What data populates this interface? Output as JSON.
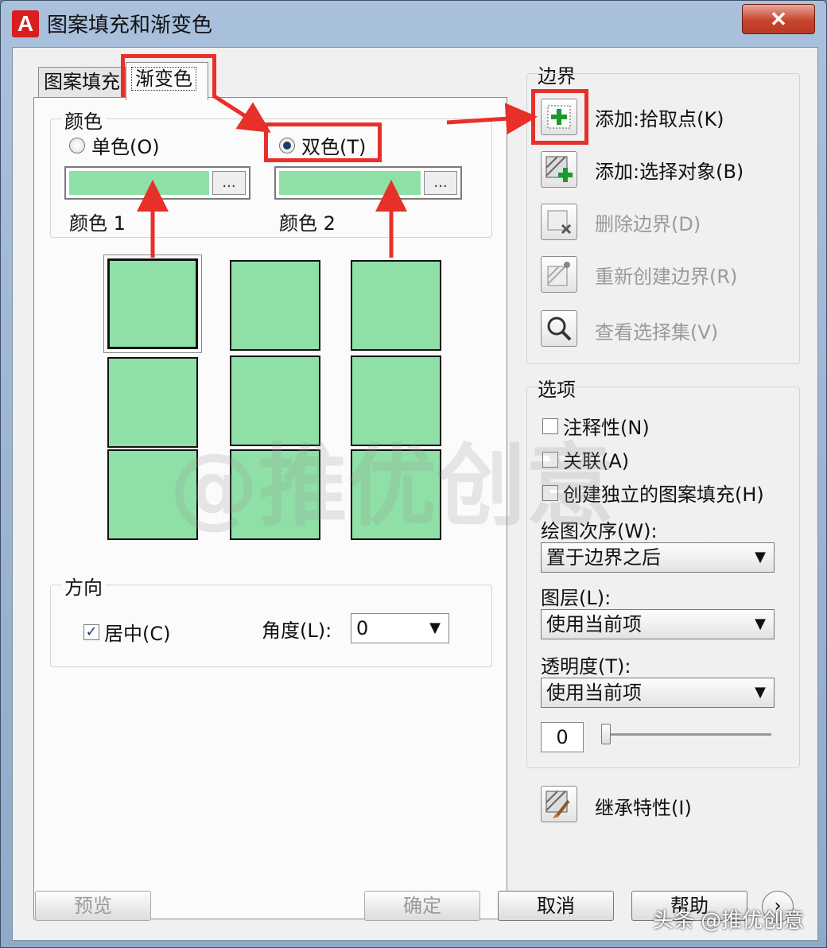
{
  "window": {
    "title": "图案填充和渐变色",
    "app_icon": "A",
    "close_glyph": "✕"
  },
  "tabs": [
    {
      "label": "图案填充"
    },
    {
      "label": "渐变色"
    }
  ],
  "color_group": {
    "label": "颜色",
    "single_color": "单色(O)",
    "two_color": "双色(T)",
    "color1_label": "颜色 1",
    "color2_label": "颜色 2",
    "color1_value": "#8fe0a6",
    "color2_value": "#8fe0a6",
    "browse": "..."
  },
  "swatch_color": "#8fe0a6",
  "direction_group": {
    "label": "方向",
    "centered": "居中(C)",
    "angle_label": "角度(L):",
    "angle_value": "0"
  },
  "boundary": {
    "label": "边界",
    "add_pick_points": "添加:拾取点(K)",
    "add_select_objects": "添加:选择对象(B)",
    "remove_boundaries": "删除边界(D)",
    "recreate_boundary": "重新创建边界(R)",
    "view_selections": "查看选择集(V)"
  },
  "options": {
    "label": "选项",
    "annotative": "注释性(N)",
    "associative": "关联(A)",
    "separate_hatches": "创建独立的图案填充(H)",
    "draw_order_label": "绘图次序(W):",
    "draw_order_value": "置于边界之后",
    "layer_label": "图层(L):",
    "layer_value": "使用当前项",
    "transparency_label": "透明度(T):",
    "transparency_value": "使用当前项",
    "transparency_number": "0"
  },
  "inherit_properties": "继承特性(I)",
  "footer": {
    "preview": "预览",
    "ok": "确定",
    "cancel": "取消",
    "help": "帮助"
  },
  "watermark": "@推优创意",
  "corner_mark": "头条 @推优创意",
  "accent_red": "#e8302a"
}
